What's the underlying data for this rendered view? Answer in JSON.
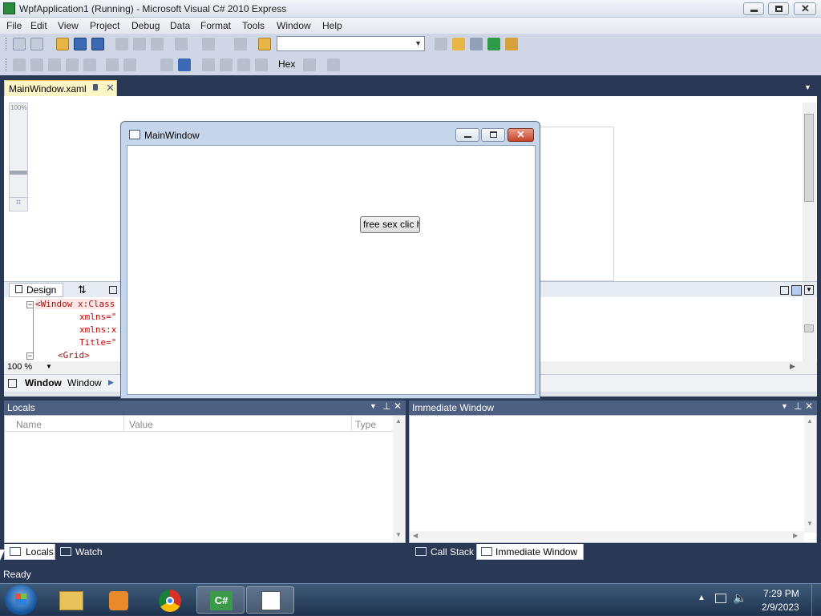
{
  "window": {
    "title": "WpfApplication1 (Running) - Microsoft Visual C# 2010 Express"
  },
  "menu": [
    "File",
    "Edit",
    "View",
    "Project",
    "Debug",
    "Data",
    "Format",
    "Tools",
    "Window",
    "Help"
  ],
  "toolbar": {
    "hex_label": "Hex",
    "combo_value": ""
  },
  "doc_tab": {
    "label": "MainWindow.xaml"
  },
  "designer": {
    "zoom_badge": "100%"
  },
  "view_tabs": {
    "design": "Design",
    "swap": "⇅"
  },
  "xaml": {
    "lines": [
      "<Window x:Class",
      "xmlns=\"",
      "xmlns:x",
      "Title=\"",
      "<Grid>"
    ]
  },
  "zoom": {
    "value": "100 %"
  },
  "breadcrumb": {
    "item1": "Window",
    "item2": "Window"
  },
  "running_window": {
    "title": "MainWindow",
    "button_label": "free sex clic h"
  },
  "locals": {
    "title": "Locals",
    "columns": [
      "Name",
      "Value",
      "Type"
    ]
  },
  "immediate": {
    "title": "Immediate Window"
  },
  "bottom_tabs_left": [
    "Locals",
    "Watch"
  ],
  "bottom_tabs_right": [
    "Call Stack",
    "Immediate Window"
  ],
  "status": {
    "text": "Ready"
  },
  "clock": {
    "time": "7:29 PM",
    "date": "2/9/2023"
  }
}
